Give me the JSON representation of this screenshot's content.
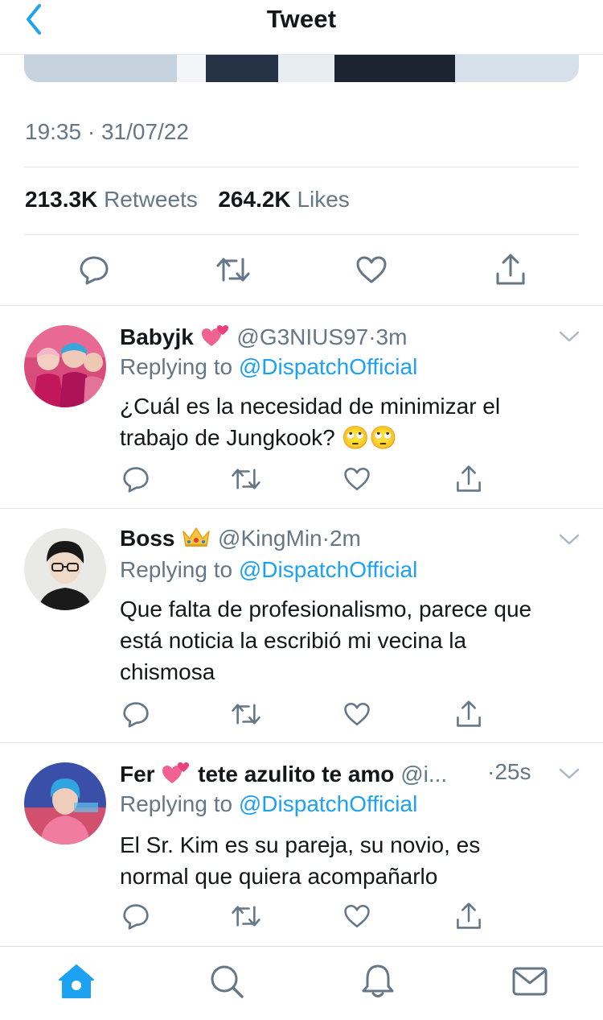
{
  "nav": {
    "title": "Tweet",
    "back_icon": "chevron-left-icon",
    "accent": "#1da1f2"
  },
  "tweet": {
    "timestamp": "19:35 · 31/07/22",
    "retweets_count": "213.3K",
    "retweets_label": "Retweets",
    "likes_count": "264.2K",
    "likes_label": "Likes",
    "actions": [
      "reply-icon",
      "retweet-icon",
      "like-icon",
      "share-icon"
    ]
  },
  "replies": [
    {
      "name": "Babyjk",
      "emoji": "💕",
      "handle": "@G3NIUS97",
      "dot": "·",
      "time": "3m",
      "replying_prefix": "Replying to",
      "replying_to": "@DispatchOfficial",
      "text_lines": [
        "¿Cuál es la necesidad de minimizar el",
        "trabajo de Jungkook? 🙄🙄"
      ]
    },
    {
      "name": "Boss",
      "emoji": "👑",
      "handle": "@KingMin",
      "dot": "·",
      "time": "2m",
      "replying_prefix": "Replying to",
      "replying_to": "@DispatchOfficial",
      "text_lines": [
        "Que falta de profesionalismo, parece que",
        "está noticia la escribió mi vecina la",
        "chismosa"
      ]
    },
    {
      "name": "Fer",
      "emoji": "💕",
      "name_suffix": "tete azulito te amo",
      "handle": "@i...",
      "dot": "·",
      "time": "25s",
      "replying_prefix": "Replying to",
      "replying_to": "@DispatchOfficial",
      "text_lines": [
        "El Sr. Kim es su pareja, su novio, es",
        "normal que quiera acompañarlo"
      ]
    }
  ],
  "tabbar": {
    "items": [
      "home-icon",
      "search-icon",
      "notifications-icon",
      "messages-icon"
    ],
    "active": "home-icon"
  }
}
